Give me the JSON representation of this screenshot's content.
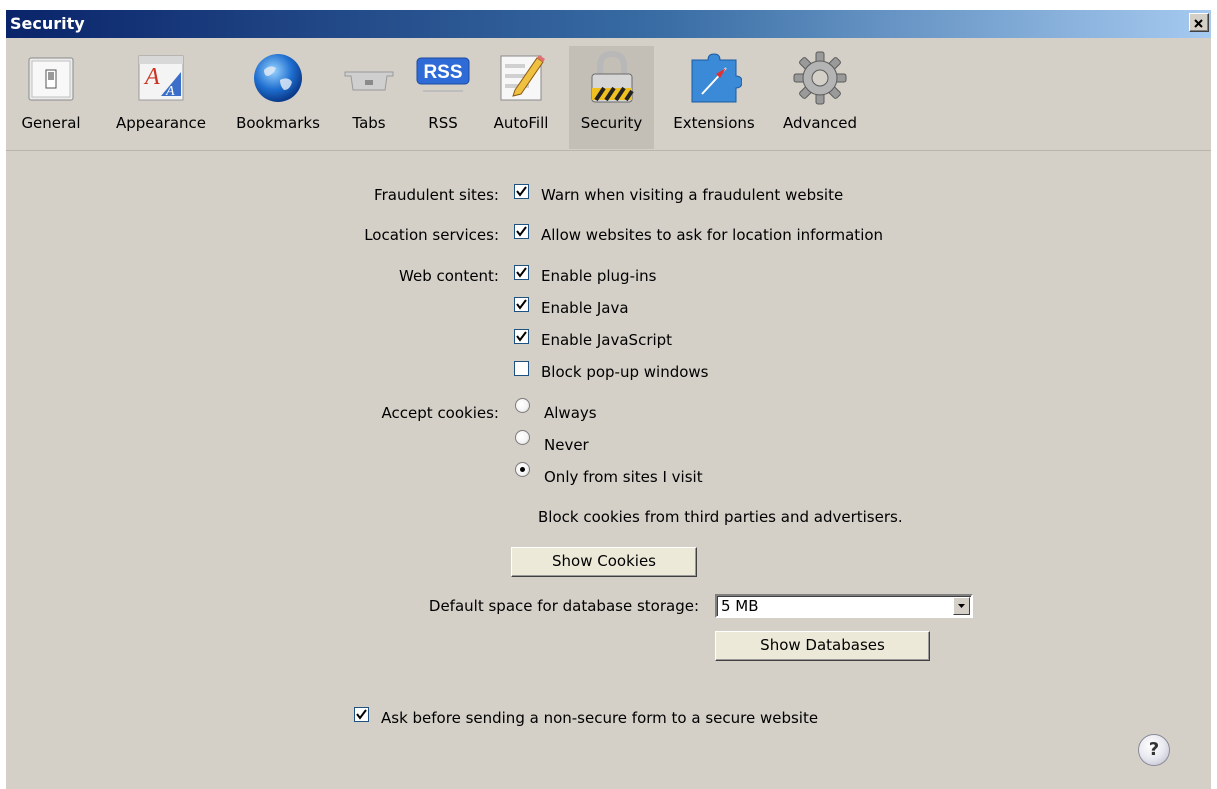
{
  "window": {
    "title": "Security"
  },
  "toolbar": {
    "items": [
      {
        "label": "General",
        "icon": "switch-icon"
      },
      {
        "label": "Appearance",
        "icon": "font-icon"
      },
      {
        "label": "Bookmarks",
        "icon": "globe-icon"
      },
      {
        "label": "Tabs",
        "icon": "tabs-icon"
      },
      {
        "label": "RSS",
        "icon": "rss-icon",
        "badge": "RSS"
      },
      {
        "label": "AutoFill",
        "icon": "pencil-form-icon"
      },
      {
        "label": "Security",
        "icon": "padlock-icon",
        "selected": true
      },
      {
        "label": "Extensions",
        "icon": "puzzle-compass-icon"
      },
      {
        "label": "Advanced",
        "icon": "gear-icon"
      }
    ]
  },
  "security": {
    "fraudulent": {
      "label": "Fraudulent sites:",
      "option": "Warn when visiting a fraudulent website",
      "checked": true
    },
    "location": {
      "label": "Location services:",
      "option": "Allow websites to ask for location information",
      "checked": true
    },
    "web_content": {
      "label": "Web content:",
      "options": [
        {
          "text": "Enable plug-ins",
          "checked": true
        },
        {
          "text": "Enable Java",
          "checked": true
        },
        {
          "text": "Enable JavaScript",
          "checked": true
        },
        {
          "text": "Block pop-up windows",
          "checked": false
        }
      ]
    },
    "cookies": {
      "label": "Accept cookies:",
      "options": [
        {
          "text": "Always",
          "selected": false
        },
        {
          "text": "Never",
          "selected": false
        },
        {
          "text": "Only from sites I visit",
          "selected": true
        }
      ],
      "note": "Block cookies from third parties and advertisers.",
      "show_button": "Show Cookies"
    },
    "database": {
      "label": "Default space for database storage:",
      "value": "5 MB",
      "show_button": "Show Databases"
    },
    "nonsecure_form": {
      "option": "Ask before sending a non-secure form to a secure website",
      "checked": true
    },
    "help": "?"
  },
  "colors": {
    "window_bg": "#d4d0c8",
    "titlebar_start": "#0a246a",
    "titlebar_end": "#a6caf0"
  }
}
